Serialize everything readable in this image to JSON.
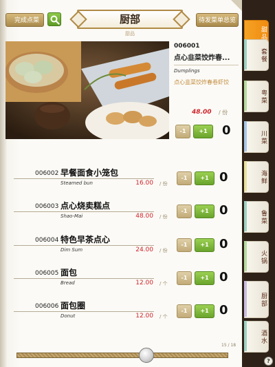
{
  "header": {
    "back_label": "完成点菜",
    "title": "厨部",
    "subtitle": "厨品",
    "order_label": "待发菜单总览"
  },
  "featured": {
    "code": "006001",
    "name": "点心韭菜饺炸春...",
    "name_en": "Dumplings",
    "description": "点心韭菜饺炸春卷虾饺",
    "price": "48.00",
    "unit": "/ 份",
    "qty": "0",
    "minus": "-1",
    "plus": "+1"
  },
  "items": [
    {
      "code": "006002",
      "name": "早餐面食小笼包",
      "name_en": "Steamed bun",
      "price": "16.00",
      "unit": "/ 份",
      "qty": "0",
      "minus": "-1",
      "plus": "+1"
    },
    {
      "code": "006003",
      "name": "点心烧卖糕点",
      "name_en": "Shao-Mai",
      "price": "48.00",
      "unit": "/ 份",
      "qty": "0",
      "minus": "-1",
      "plus": "+1"
    },
    {
      "code": "006004",
      "name": "特色早茶点心",
      "name_en": "Dim Sum",
      "price": "24.00",
      "unit": "/ 份",
      "qty": "0",
      "minus": "-1",
      "plus": "+1"
    },
    {
      "code": "006005",
      "name": "面包",
      "name_en": "Bread",
      "price": "12.00",
      "unit": "/ 个",
      "qty": "0",
      "minus": "-1",
      "plus": "+1"
    },
    {
      "code": "006006",
      "name": "面包圈",
      "name_en": "Donut",
      "price": "12.00",
      "unit": "/ 个",
      "qty": "0",
      "minus": "-1",
      "plus": "+1"
    }
  ],
  "pagination": {
    "page": "15 / 18"
  },
  "side_tabs": [
    {
      "label": "甜品",
      "active": true
    },
    {
      "label": "套餐"
    },
    {
      "label": "粤菜"
    },
    {
      "label": "川菜"
    },
    {
      "label": "海鲜"
    },
    {
      "label": "鲁菜"
    },
    {
      "label": "火锅"
    },
    {
      "label": "厨部"
    },
    {
      "label": "酒水"
    }
  ],
  "help": "?",
  "colors": {
    "accent_orange": "#ef8b10",
    "plus_green": "#6aa42c",
    "minus_tan": "#c2ab78",
    "price_red": "#d0242c",
    "gold": "#b08a45"
  },
  "icons": {
    "search": "search-icon"
  }
}
